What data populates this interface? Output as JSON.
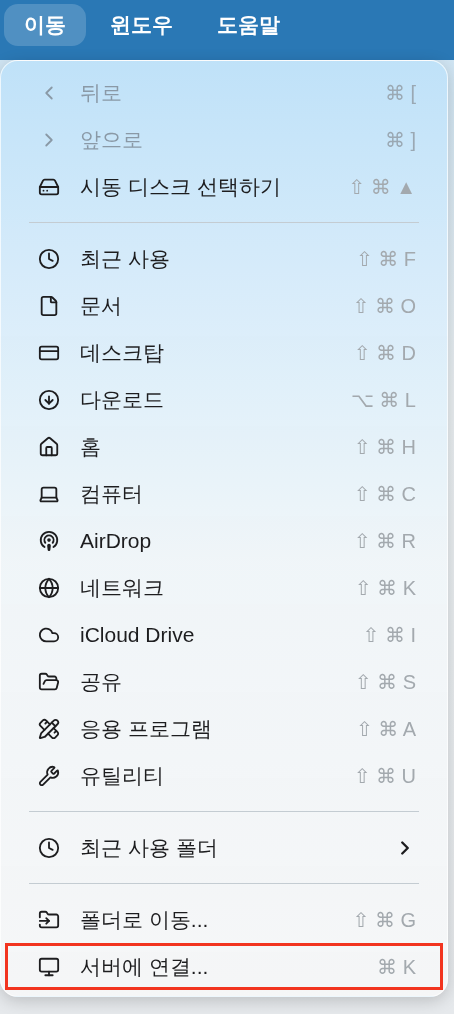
{
  "menu_bar": [
    {
      "label": "이동",
      "selected": true
    },
    {
      "label": "윈도우",
      "selected": false
    },
    {
      "label": "도움말",
      "selected": false
    }
  ],
  "menu": [
    {
      "kind": "item",
      "label": "뒤로",
      "shortcut": "⌘ [",
      "disabled": true,
      "outlined": false
    },
    {
      "kind": "item",
      "label": "앞으로",
      "shortcut": "⌘ ]",
      "disabled": true,
      "outlined": false
    },
    {
      "kind": "item",
      "label": "시동 디스크 선택하기",
      "shortcut": "⇧ ⌘ ▲",
      "disabled": false,
      "outlined": false
    },
    {
      "kind": "separator"
    },
    {
      "kind": "item",
      "label": "최근 사용",
      "shortcut": "⇧ ⌘ F",
      "disabled": false,
      "outlined": false
    },
    {
      "kind": "item",
      "label": "문서",
      "shortcut": "⇧ ⌘ O",
      "disabled": false,
      "outlined": false
    },
    {
      "kind": "item",
      "label": "데스크탑",
      "shortcut": "⇧ ⌘ D",
      "disabled": false,
      "outlined": false
    },
    {
      "kind": "item",
      "label": "다운로드",
      "shortcut": "⌥ ⌘ L",
      "disabled": false,
      "outlined": false
    },
    {
      "kind": "item",
      "label": "홈",
      "shortcut": "⇧ ⌘ H",
      "disabled": false,
      "outlined": false
    },
    {
      "kind": "item",
      "label": "컴퓨터",
      "shortcut": "⇧ ⌘ C",
      "disabled": false,
      "outlined": false
    },
    {
      "kind": "item",
      "label": "AirDrop",
      "shortcut": "⇧ ⌘ R",
      "disabled": false,
      "outlined": false
    },
    {
      "kind": "item",
      "label": "네트워크",
      "shortcut": "⇧ ⌘ K",
      "disabled": false,
      "outlined": false
    },
    {
      "kind": "item",
      "label": "iCloud Drive",
      "shortcut": "⇧ ⌘ I",
      "disabled": false,
      "outlined": false
    },
    {
      "kind": "item",
      "label": "공유",
      "shortcut": "⇧ ⌘ S",
      "disabled": false,
      "outlined": false
    },
    {
      "kind": "item",
      "label": "응용 프로그램",
      "shortcut": "⇧ ⌘ A",
      "disabled": false,
      "outlined": false
    },
    {
      "kind": "item",
      "label": "유틸리티",
      "shortcut": "⇧ ⌘ U",
      "disabled": false,
      "outlined": false
    },
    {
      "kind": "separator"
    },
    {
      "kind": "submenu",
      "label": "최근 사용 폴더",
      "disabled": false,
      "outlined": false
    },
    {
      "kind": "separator"
    },
    {
      "kind": "item",
      "label": "폴더로 이동...",
      "shortcut": "⇧ ⌘ G",
      "disabled": false,
      "outlined": false
    },
    {
      "kind": "item",
      "label": "서버에 연결...",
      "shortcut": "⌘ K",
      "disabled": false,
      "outlined": true
    }
  ]
}
